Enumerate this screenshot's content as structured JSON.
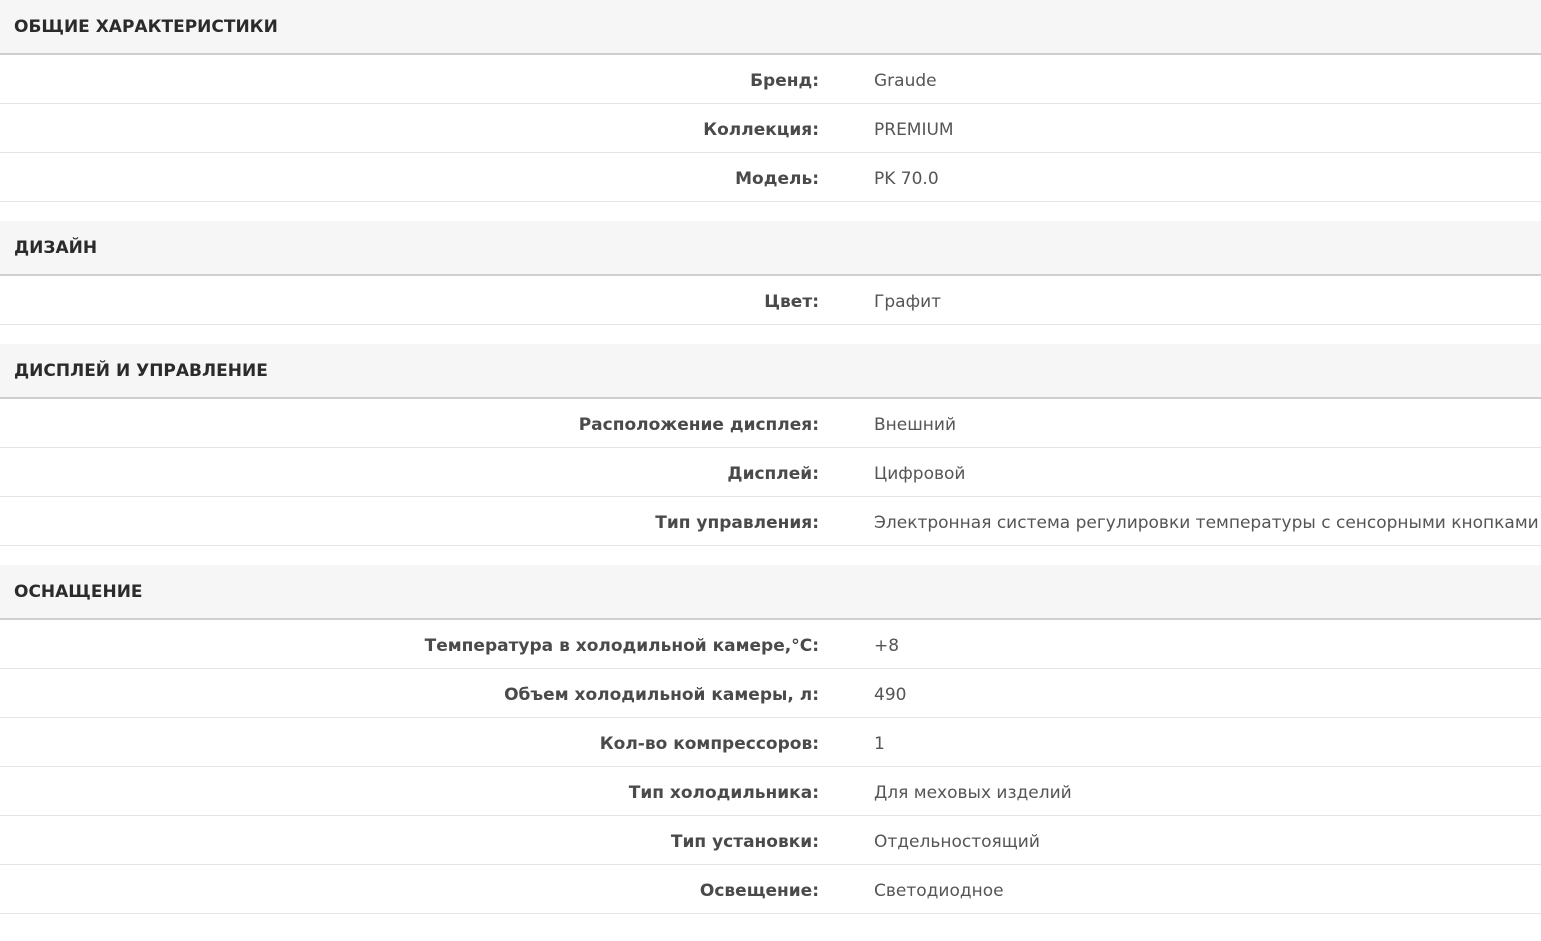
{
  "sections": [
    {
      "title": "ОБЩИЕ ХАРАКТЕРИСТИКИ",
      "rows": [
        {
          "label": "Бренд:",
          "value": "Graude"
        },
        {
          "label": "Коллекция:",
          "value": "PREMIUM"
        },
        {
          "label": "Модель:",
          "value": "PK 70.0"
        }
      ]
    },
    {
      "title": "ДИЗАЙН",
      "rows": [
        {
          "label": "Цвет:",
          "value": "Графит"
        }
      ]
    },
    {
      "title": "ДИСПЛЕЙ И УПРАВЛЕНИЕ",
      "rows": [
        {
          "label": "Расположение дисплея:",
          "value": "Внешний"
        },
        {
          "label": "Дисплей:",
          "value": "Цифровой"
        },
        {
          "label": "Тип управления:",
          "value": "Электронная система регулировки температуры с сенсорными кнопками"
        }
      ]
    },
    {
      "title": "ОСНАЩЕНИЕ",
      "rows": [
        {
          "label": "Температура в холодильной камере,°C:",
          "value": "+8"
        },
        {
          "label": "Объем холодильной камеры, л:",
          "value": "490"
        },
        {
          "label": "Кол-во компрессоров:",
          "value": "1"
        },
        {
          "label": "Тип холодильника:",
          "value": "Для меховых изделий"
        },
        {
          "label": "Тип установки:",
          "value": "Отдельностоящий"
        },
        {
          "label": "Освещение:",
          "value": "Светодиодное"
        }
      ]
    }
  ]
}
